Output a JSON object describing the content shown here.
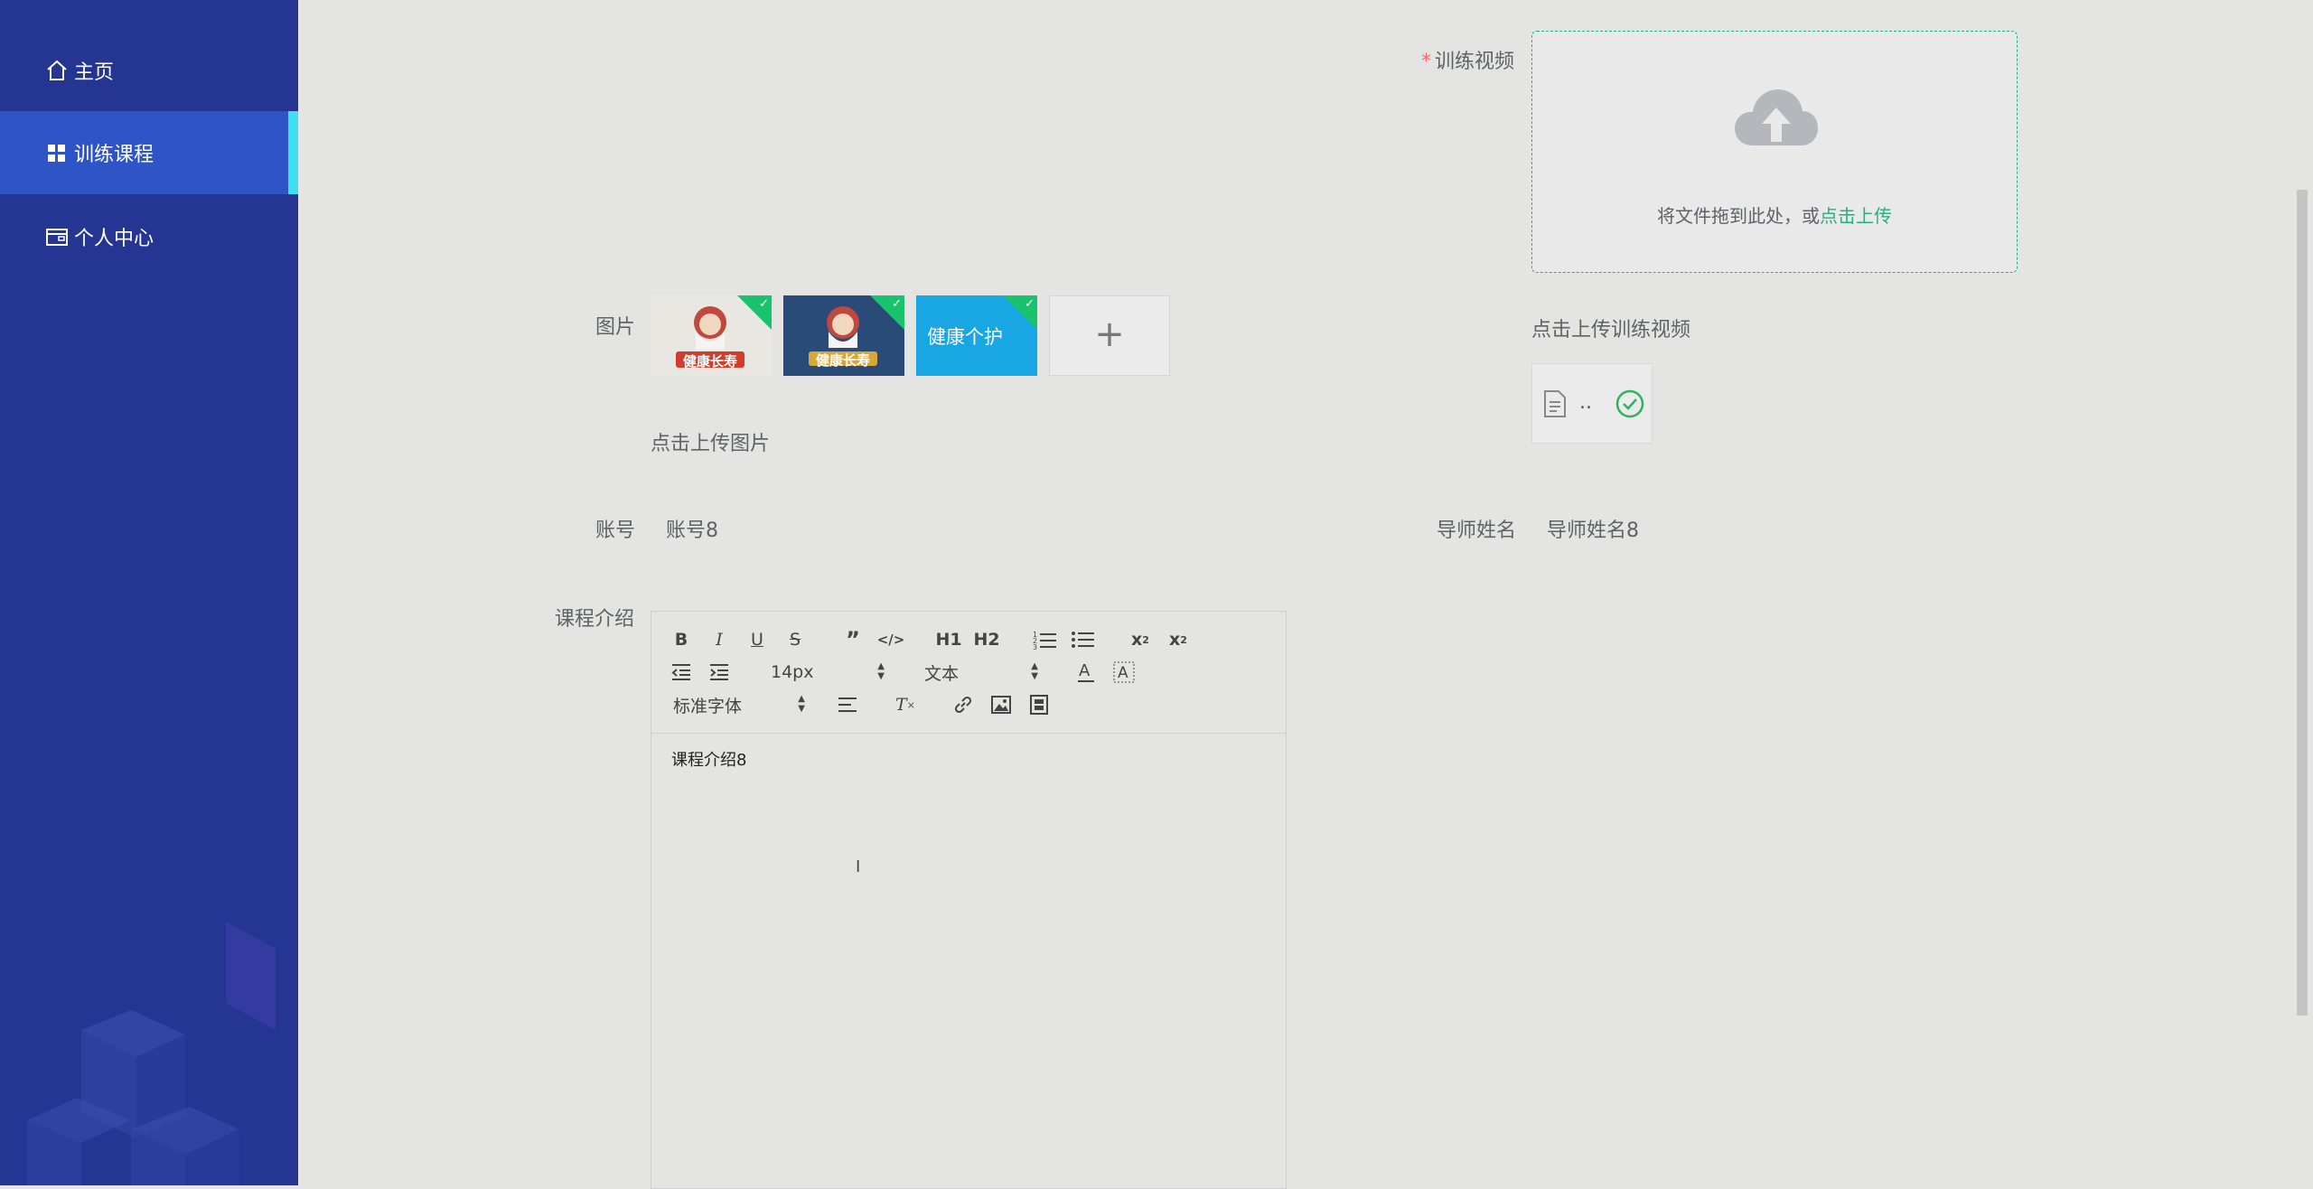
{
  "sidebar": {
    "items": [
      {
        "label": "主页",
        "icon": "home-icon"
      },
      {
        "label": "训练课程",
        "icon": "grid-icon"
      },
      {
        "label": "个人中心",
        "icon": "wallet-icon"
      }
    ],
    "active_index": 1
  },
  "form": {
    "video": {
      "required_mark": "*",
      "label": "训练视频",
      "drag_text": "将文件拖到此处，或",
      "drag_link": "点击上传",
      "hint": "点击上传训练视频",
      "file_name": ".."
    },
    "images": {
      "label": "图片",
      "thumbnails": [
        {
          "alt_text": "健康长寿",
          "bg": "#e9e7e2"
        },
        {
          "alt_text": "健康长寿",
          "bg": "#2a4a78"
        },
        {
          "alt_text": "健康个护",
          "bg": "#19a7e4"
        }
      ],
      "add_symbol": "+",
      "hint": "点击上传图片"
    },
    "account": {
      "label": "账号",
      "value": "账号8"
    },
    "mentor": {
      "label": "导师姓名",
      "value": "导师姓名8"
    },
    "intro": {
      "label": "课程介绍",
      "toolbar": {
        "font_size": "14px",
        "block_type": "文本",
        "font_family": "标准字体",
        "h1": "H1",
        "h2": "H2"
      },
      "content": "课程介绍8"
    }
  },
  "colors": {
    "sidebar_bg": "#243592",
    "sidebar_active": "#2e54c6",
    "accent": "#22b08a",
    "required": "#f56c6c"
  }
}
